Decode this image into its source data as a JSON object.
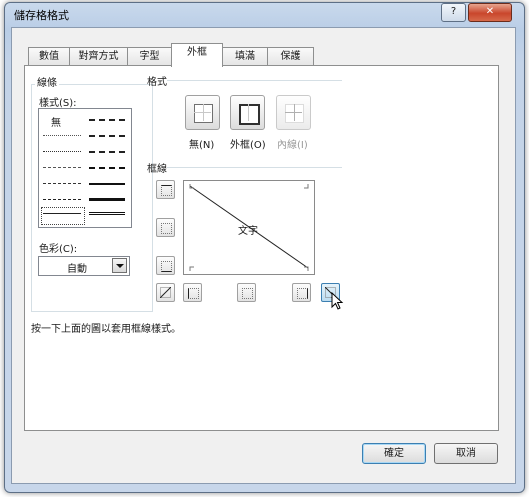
{
  "window": {
    "title": "儲存格格式",
    "help_label": "?",
    "close_label": "✕"
  },
  "tabs": [
    {
      "label": "數值"
    },
    {
      "label": "對齊方式"
    },
    {
      "label": "字型"
    },
    {
      "label": "外框"
    },
    {
      "label": "填滿"
    },
    {
      "label": "保護"
    }
  ],
  "active_tab": "外框",
  "line": {
    "group_label": "線條",
    "style_label": "樣式(S):",
    "none_label": "無",
    "color_label": "色彩(C):",
    "color_value": "自動"
  },
  "presets": {
    "group_label": "格式",
    "none": "無(N)",
    "outline": "外框(O)",
    "inside": "內線(I)"
  },
  "border": {
    "group_label": "框線",
    "preview_text": "文字"
  },
  "hint": "按一下上面的圖以套用框線樣式。",
  "buttons": {
    "ok": "確定",
    "cancel": "取消"
  }
}
